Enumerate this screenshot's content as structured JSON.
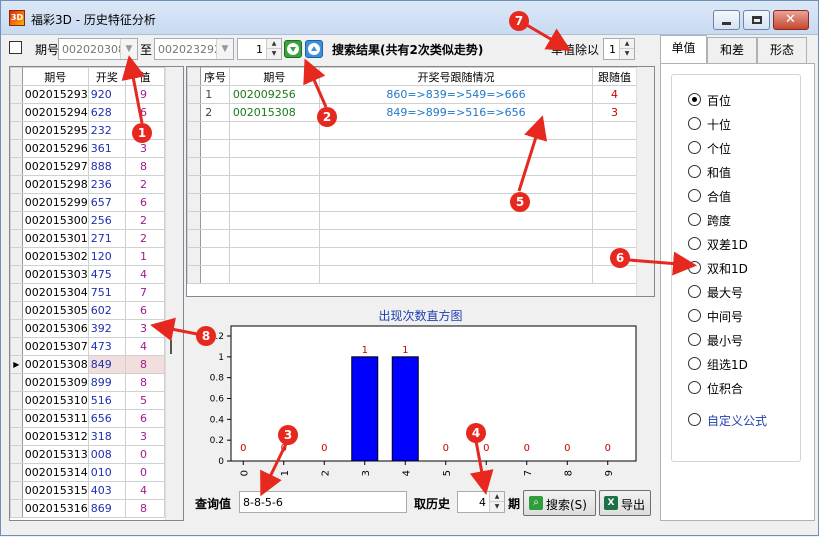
{
  "window": {
    "title": "福彩3D - 历史特征分析",
    "icon_text": "3D"
  },
  "toolbar": {
    "period_label": "期号",
    "from_value": "002020308",
    "to_label": "至",
    "to_value": "002023292",
    "step_value": "1",
    "result_label": "搜索结果(共有2次类似走势)",
    "divide_label": "单值除以",
    "divide_value": "1"
  },
  "left_table": {
    "headers": [
      "期号",
      "开奖",
      "值"
    ],
    "rows": [
      [
        "002015293",
        "920",
        "9"
      ],
      [
        "002015294",
        "628",
        "6"
      ],
      [
        "002015295",
        "232",
        "2"
      ],
      [
        "002015296",
        "361",
        "3"
      ],
      [
        "002015297",
        "888",
        "8"
      ],
      [
        "002015298",
        "236",
        "2"
      ],
      [
        "002015299",
        "657",
        "6"
      ],
      [
        "002015300",
        "256",
        "2"
      ],
      [
        "002015301",
        "271",
        "2"
      ],
      [
        "002015302",
        "120",
        "1"
      ],
      [
        "002015303",
        "475",
        "4"
      ],
      [
        "002015304",
        "751",
        "7"
      ],
      [
        "002015305",
        "602",
        "6"
      ],
      [
        "002015306",
        "392",
        "3"
      ],
      [
        "002015307",
        "473",
        "4"
      ],
      [
        "002015308",
        "849",
        "8"
      ],
      [
        "002015309",
        "899",
        "8"
      ],
      [
        "002015310",
        "516",
        "5"
      ],
      [
        "002015311",
        "656",
        "6"
      ],
      [
        "002015312",
        "318",
        "3"
      ],
      [
        "002015313",
        "008",
        "0"
      ],
      [
        "002015314",
        "010",
        "0"
      ],
      [
        "002015315",
        "403",
        "4"
      ],
      [
        "002015316",
        "869",
        "8"
      ]
    ],
    "selected_row": 15
  },
  "result_table": {
    "headers": [
      "序号",
      "期号",
      "开奖号跟随情况",
      "跟随值"
    ],
    "rows": [
      [
        "1",
        "002009256",
        "860=>839=>549=>666",
        "4"
      ],
      [
        "2",
        "002015308",
        "849=>899=>516=>656",
        "3"
      ]
    ]
  },
  "chart_data": {
    "type": "bar",
    "title": "出现次数直方图",
    "categories": [
      "0",
      "1",
      "2",
      "3",
      "4",
      "5",
      "6",
      "7",
      "8",
      "9"
    ],
    "values": [
      0,
      0,
      0,
      1,
      1,
      0,
      0,
      0,
      0,
      0
    ],
    "ylim": [
      0,
      1.2
    ],
    "yticks": [
      "0",
      "0.2",
      "0.4",
      "0.6",
      "0.8",
      "1",
      "1.2"
    ],
    "bar_color": "#0000ff",
    "label_color": "#cc0000"
  },
  "bottom": {
    "query_label": "查询值",
    "query_value": "8-8-5-6",
    "history_label": "取历史",
    "history_value": "4",
    "period_unit": "期",
    "search_label": "搜索(S)",
    "export_label": "导出"
  },
  "right_panel": {
    "tabs": [
      "单值",
      "和差",
      "形态"
    ],
    "active_tab": 0,
    "options": [
      "百位",
      "十位",
      "个位",
      "和值",
      "合值",
      "跨度",
      "双差1D",
      "双和1D",
      "最大号",
      "中间号",
      "最小号",
      "组选1D",
      "位积合",
      "自定义公式"
    ],
    "selected_option": 0
  },
  "annotations": [
    "1",
    "2",
    "3",
    "4",
    "5",
    "6",
    "7",
    "8"
  ]
}
